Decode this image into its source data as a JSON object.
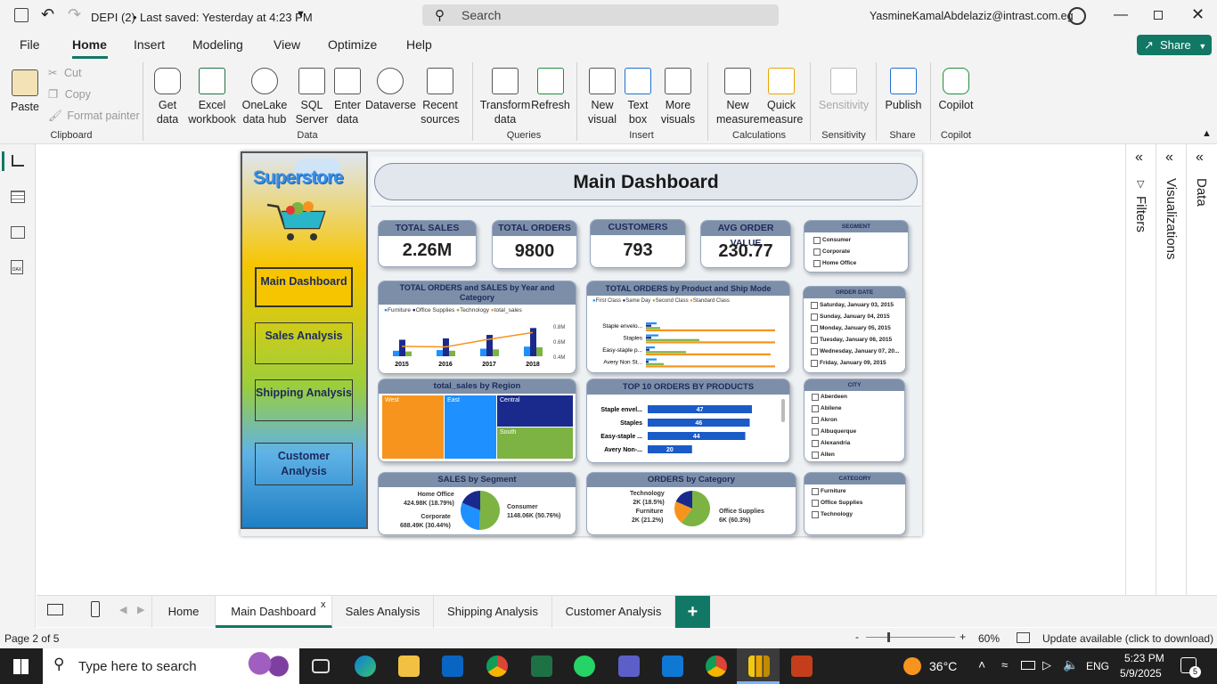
{
  "titlebar": {
    "file": "DEPI (2)",
    "saved": "Last saved: Yesterday at 4:23 PM",
    "search_placeholder": "Search",
    "user": "YasmineKamalAbdelaziz@intrast.com.eg"
  },
  "menu": [
    "File",
    "Home",
    "Insert",
    "Modeling",
    "View",
    "Optimize",
    "Help"
  ],
  "share": "Share",
  "ribbon": {
    "paste": "Paste",
    "cut": "Cut",
    "copy": "Copy",
    "format_painter": "Format painter",
    "get_data": "Get data",
    "excel": "Excel workbook",
    "onelake": "OneLake data hub",
    "sql": "SQL Server",
    "enter": "Enter data",
    "dataverse": "Dataverse",
    "recent": "Recent sources",
    "transform": "Transform data",
    "refresh": "Refresh",
    "new_visual": "New visual",
    "text_box": "Text box",
    "more_visuals": "More visuals",
    "new_measure": "New measure",
    "quick_measure": "Quick measure",
    "sensitivity": "Sensitivity",
    "publish": "Publish",
    "copilot": "Copilot",
    "groups": [
      "Clipboard",
      "Data",
      "Queries",
      "Insert",
      "Calculations",
      "Sensitivity",
      "Share",
      "Copilot"
    ]
  },
  "report": {
    "logo": "Superstore",
    "title": "Main Dashboard",
    "nav": [
      "Main Dashboard",
      "Sales Analysis",
      "Shipping Analysis",
      "Customer Analysis"
    ],
    "kpis": [
      {
        "label": "TOTAL SALES",
        "value": "2.26M"
      },
      {
        "label": "TOTAL ORDERS",
        "value": "9800"
      },
      {
        "label": "CUSTOMERS",
        "value": "793"
      },
      {
        "label": "AVG ORDER VALUE",
        "value": "230.77"
      }
    ],
    "segment": {
      "title": "SEGMENT",
      "items": [
        "Consumer",
        "Corporate",
        "Home Office"
      ]
    },
    "order_date": {
      "title": "ORDER DATE",
      "items": [
        "Saturday, January 03, 2015",
        "Sunday, January 04, 2015",
        "Monday, January 05, 2015",
        "Tuesday, January 06, 2015",
        "Wednesday, January 07, 20...",
        "Friday, January 09, 2015"
      ]
    },
    "city": {
      "title": "CITY",
      "items": [
        "Aberdeen",
        "Abilene",
        "Akron",
        "Albuquerque",
        "Alexandria",
        "Allen"
      ]
    },
    "category": {
      "title": "CATEGORY",
      "items": [
        "Furniture",
        "Office Supplies",
        "Technology"
      ]
    },
    "c1": {
      "title": "TOTAL ORDERS and SALES by Year and Category",
      "legend": [
        "Furniture",
        "Office Supplies",
        "Technology",
        "total_sales"
      ],
      "x": [
        "2015",
        "2016",
        "2017",
        "2018"
      ],
      "y2ticks": [
        "0.8M",
        "0.6M",
        "0.4M"
      ]
    },
    "c2": {
      "title": "TOTAL ORDERS by Product and Ship Mode",
      "legend": [
        "First Class",
        "Same Day",
        "Second Class",
        "Standard Class"
      ],
      "cats": [
        "Staple envelo...",
        "Staples",
        "Easy-staple p...",
        "Avery Non St..."
      ]
    },
    "c3": {
      "title": "total_sales by Region",
      "regions": [
        "West",
        "East",
        "Central",
        "South"
      ]
    },
    "c4": {
      "title": "TOP 10 ORDERS BY PRODUCTS",
      "cats": [
        "Staple envel...",
        "Staples",
        "Easy-staple ...",
        "Avery Non-..."
      ],
      "values": [
        "47",
        "46",
        "44",
        "20"
      ]
    },
    "c5": {
      "title": "SALES by Segment",
      "l1": "Home Office",
      "l1v": "424.98K (18.79%)",
      "l2": "Corporate",
      "l2v": "688.49K (30.44%)",
      "l3": "Consumer",
      "l3v": "1148.06K (50.76%)"
    },
    "c6": {
      "title": "ORDERS by Category",
      "l1": "Technology",
      "l1v": "2K (18.5%)",
      "l2": "Furniture",
      "l2v": "2K (21.2%)",
      "l3": "Office Supplies",
      "l3v": "6K (60.3%)"
    }
  },
  "chart_data": [
    {
      "type": "bar",
      "title": "TOTAL ORDERS and SALES by Year and Category",
      "categories": [
        "2015",
        "2016",
        "2017",
        "2018"
      ],
      "series": [
        {
          "name": "Furniture",
          "values": [
            400,
            450,
            550,
            700
          ]
        },
        {
          "name": "Office Supplies",
          "values": [
            1200,
            1300,
            1550,
            2050
          ]
        },
        {
          "name": "Technology",
          "values": [
            350,
            400,
            500,
            650
          ]
        },
        {
          "name": "total_sales",
          "values": [
            0.48,
            0.47,
            0.61,
            0.73
          ]
        }
      ]
    },
    {
      "type": "bar",
      "title": "TOP 10 ORDERS BY PRODUCTS",
      "categories": [
        "Staple envel...",
        "Staples",
        "Easy-staple ...",
        "Avery Non-..."
      ],
      "values": [
        47,
        46,
        44,
        20
      ]
    },
    {
      "type": "pie",
      "title": "SALES by Segment",
      "categories": [
        "Consumer",
        "Corporate",
        "Home Office"
      ],
      "values": [
        50.76,
        30.44,
        18.79
      ]
    },
    {
      "type": "pie",
      "title": "ORDERS by Category",
      "categories": [
        "Office Supplies",
        "Furniture",
        "Technology"
      ],
      "values": [
        60.3,
        21.2,
        18.5
      ]
    }
  ],
  "panes": {
    "filters": "Filters",
    "visualizations": "Visualizations",
    "data": "Data"
  },
  "pages": [
    "Home",
    "Main Dashboard",
    "Sales Analysis",
    "Shipping Analysis",
    "Customer Analysis"
  ],
  "status": {
    "page": "Page 2 of 5",
    "zoom": "60%",
    "update": "Update available (click to download)"
  },
  "taskbar": {
    "search": "Type here to search",
    "temp": "36°C",
    "lang": "ENG",
    "time": "5:23 PM",
    "date": "5/9/2025",
    "notif": "5"
  },
  "colors": {
    "accent": "#117865",
    "navy": "#1a2a8c",
    "orange": "#f7941d",
    "blue": "#1e90ff",
    "green": "#7cb342"
  }
}
